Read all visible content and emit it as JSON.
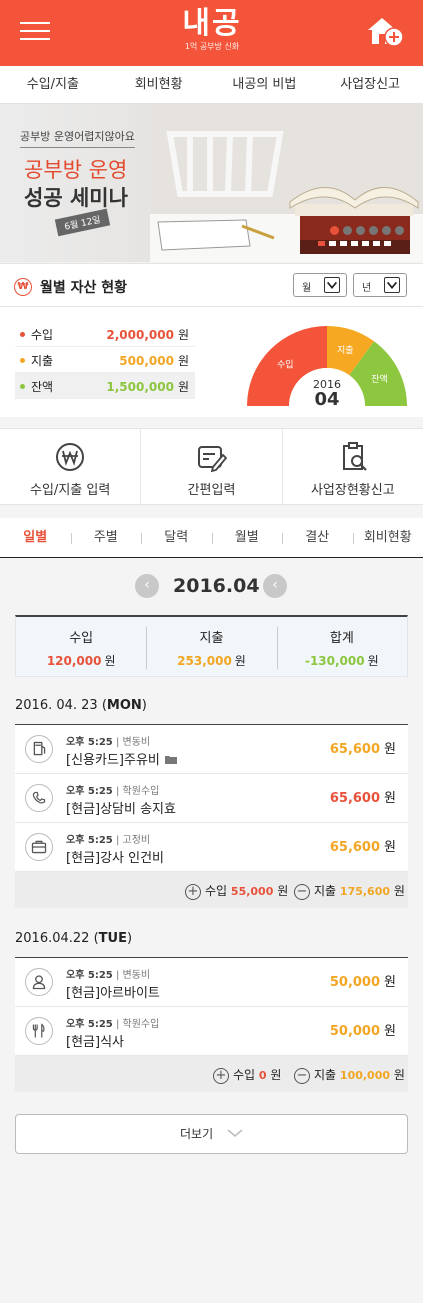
{
  "header": {
    "logo_text": "내공",
    "logo_sub": "1억 공부방 신화",
    "menu_icon": "hamburger-icon",
    "home_icon": "home-add-icon"
  },
  "top_nav": [
    "수입/지출",
    "회비현황",
    "내공의 비법",
    "사업장신고"
  ],
  "banner": {
    "question": "공부방 운영어렵지않아요",
    "title_line1": "공부방 운영",
    "title_line2": "성공 세미나",
    "date": "6월 12일",
    "slide_count": 7,
    "active_slide": 1
  },
  "assets": {
    "title": "월별 자산 현황",
    "icon": "won-circle-icon",
    "select_month": "월",
    "select_year": "년",
    "unit": "원",
    "rows": [
      {
        "label": "수입",
        "value": "2,000,000",
        "color": "#e8523a"
      },
      {
        "label": "지출",
        "value": "500,000",
        "color": "#f2a623"
      },
      {
        "label": "잔액",
        "value": "1,500,000",
        "color": "#8cc63f"
      }
    ],
    "gauge": {
      "year": "2016",
      "month": "04",
      "labels": [
        "수입",
        "지출",
        "잔액"
      ],
      "shares": [
        0.5,
        0.2,
        0.3
      ],
      "colors": [
        "#f4553a",
        "#f7a823",
        "#8dc63f"
      ]
    }
  },
  "quick_menu": [
    {
      "label": "수입/지출 입력",
      "icon": "won-coin-icon"
    },
    {
      "label": "간편입력",
      "icon": "pencil-card-icon"
    },
    {
      "label": "사업장현황신고",
      "icon": "clipboard-search-icon"
    }
  ],
  "tabs": {
    "items": [
      "일별",
      "주별",
      "달력",
      "월별",
      "결산",
      "회비현황"
    ],
    "active": "일별"
  },
  "month_nav": {
    "label": "2016.04",
    "prev": "‹",
    "next": "‹"
  },
  "summary": [
    {
      "label": "수입",
      "value": "120,000",
      "color": "#e8523a"
    },
    {
      "label": "지출",
      "value": "253,000",
      "color": "#f2a623"
    },
    {
      "label": "합계",
      "value": "-130,000",
      "color": "#8cc63f"
    }
  ],
  "currency": "원",
  "days": [
    {
      "date": "2016. 04. 23 (",
      "weekday": "MON",
      "close": ")",
      "items": [
        {
          "time": "오후 5:25",
          "category": "변동비",
          "title": "[신용카드]주유비",
          "amount": "65,600",
          "color": "#f2a623",
          "icon": "fuel-pump-icon",
          "has_folder": true
        },
        {
          "time": "오후 5:25",
          "category": "학원수입",
          "title": "[현금]상담비 송지효",
          "amount": "65,600",
          "color": "#e8523a",
          "icon": "phone-icon",
          "has_folder": false
        },
        {
          "time": "오후 5:25",
          "category": "고정비",
          "title": "[현금]강사 인건비",
          "amount": "65,600",
          "color": "#f2a623",
          "icon": "briefcase-icon",
          "has_folder": false
        }
      ],
      "total": {
        "income_label": "수입",
        "income": "55,000",
        "expense_label": "지출",
        "expense": "175,600"
      }
    },
    {
      "date": "2016.04.22 (",
      "weekday": "TUE",
      "close": ")",
      "items": [
        {
          "time": "오후 5:25",
          "category": "변동비",
          "title": "[현금]아르바이트",
          "amount": "50,000",
          "color": "#f2a623",
          "icon": "person-icon",
          "has_folder": false
        },
        {
          "time": "오후 5:25",
          "category": "학원수입",
          "title": "[현금]식사",
          "amount": "50,000",
          "color": "#f2a623",
          "icon": "fork-knife-icon",
          "has_folder": false
        }
      ],
      "total": {
        "income_label": "수입",
        "income": "0",
        "expense_label": "지출",
        "expense": "100,000"
      }
    }
  ],
  "more_button": "더보기"
}
